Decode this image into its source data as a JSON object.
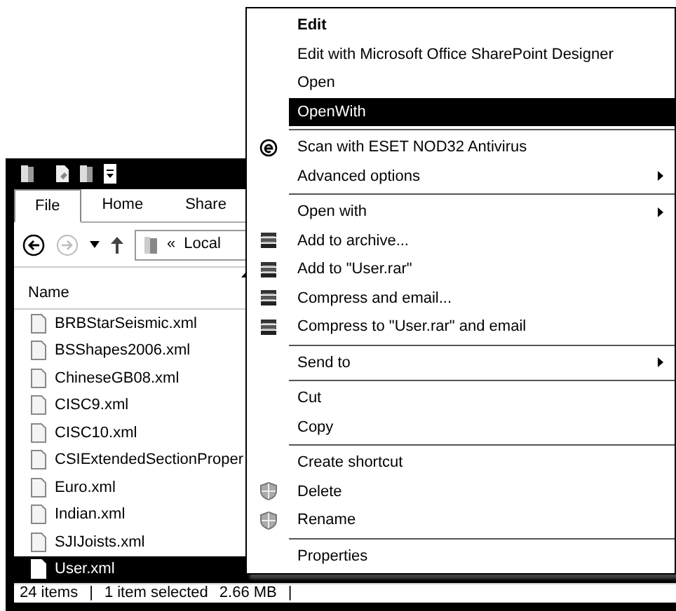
{
  "explorer": {
    "ribbon_tabs": [
      {
        "label": "File",
        "selected": true
      },
      {
        "label": "Home",
        "selected": false
      },
      {
        "label": "Share",
        "selected": false
      }
    ],
    "address": {
      "chevron": "«",
      "location": "Local"
    },
    "column_header": "Name",
    "files": [
      {
        "name": "BRBStarSeismic.xml",
        "selected": false
      },
      {
        "name": "BSShapes2006.xml",
        "selected": false
      },
      {
        "name": "ChineseGB08.xml",
        "selected": false
      },
      {
        "name": "CISC9.xml",
        "selected": false
      },
      {
        "name": "CISC10.xml",
        "selected": false
      },
      {
        "name": "CSIExtendedSectionProper",
        "selected": false
      },
      {
        "name": "Euro.xml",
        "selected": false
      },
      {
        "name": "Indian.xml",
        "selected": false
      },
      {
        "name": "SJIJoists.xml",
        "selected": false
      },
      {
        "name": "User.xml",
        "selected": true
      }
    ],
    "status_bar": [
      "24 items",
      "|",
      "1 item selected",
      "2.66 MB",
      "|"
    ]
  },
  "context_menu": {
    "items": [
      {
        "kind": "item",
        "label": "Edit",
        "default": true,
        "selected": false,
        "submenu": false
      },
      {
        "kind": "item",
        "label": "Edit with Microsoft Office SharePoint Designer",
        "default": false,
        "selected": false,
        "submenu": false
      },
      {
        "kind": "item",
        "label": "Open",
        "default": false,
        "selected": false,
        "submenu": false
      },
      {
        "kind": "item",
        "label": "OpenWith",
        "default": false,
        "selected": true,
        "submenu": false
      },
      {
        "kind": "separator"
      },
      {
        "kind": "antivirus",
        "label": "Scan with ESET NOD32 Antivirus",
        "default": false,
        "selected": false,
        "submenu": false
      },
      {
        "kind": "item",
        "label": "Advanced options",
        "default": false,
        "selected": false,
        "submenu": true
      },
      {
        "kind": "separator"
      },
      {
        "kind": "item",
        "label": "Open with",
        "default": false,
        "selected": false,
        "submenu": true
      },
      {
        "kind": "archive",
        "label": "Add to archive...",
        "default": false,
        "selected": false,
        "submenu": false
      },
      {
        "kind": "archive",
        "label": "Add to \"User.rar\"",
        "default": false,
        "selected": false,
        "submenu": false
      },
      {
        "kind": "archive",
        "label": "Compress and email...",
        "default": false,
        "selected": false,
        "submenu": false
      },
      {
        "kind": "archive",
        "label": "Compress to \"User.rar\" and email",
        "default": false,
        "selected": false,
        "submenu": false
      },
      {
        "kind": "separator"
      },
      {
        "kind": "item",
        "label": "Send to",
        "default": false,
        "selected": false,
        "submenu": true
      },
      {
        "kind": "separator"
      },
      {
        "kind": "item",
        "label": "Cut",
        "default": false,
        "selected": false,
        "submenu": false
      },
      {
        "kind": "item",
        "label": "Copy",
        "default": false,
        "selected": false,
        "submenu": false
      },
      {
        "kind": "separator"
      },
      {
        "kind": "item",
        "label": "Create shortcut",
        "default": false,
        "selected": false,
        "submenu": false
      },
      {
        "kind": "admin",
        "label": "Delete",
        "default": false,
        "selected": false,
        "submenu": false
      },
      {
        "kind": "admin",
        "label": "Rename",
        "default": false,
        "selected": false,
        "submenu": false
      },
      {
        "kind": "separator"
      },
      {
        "kind": "item",
        "label": "Properties",
        "default": false,
        "selected": false,
        "submenu": false
      }
    ]
  }
}
